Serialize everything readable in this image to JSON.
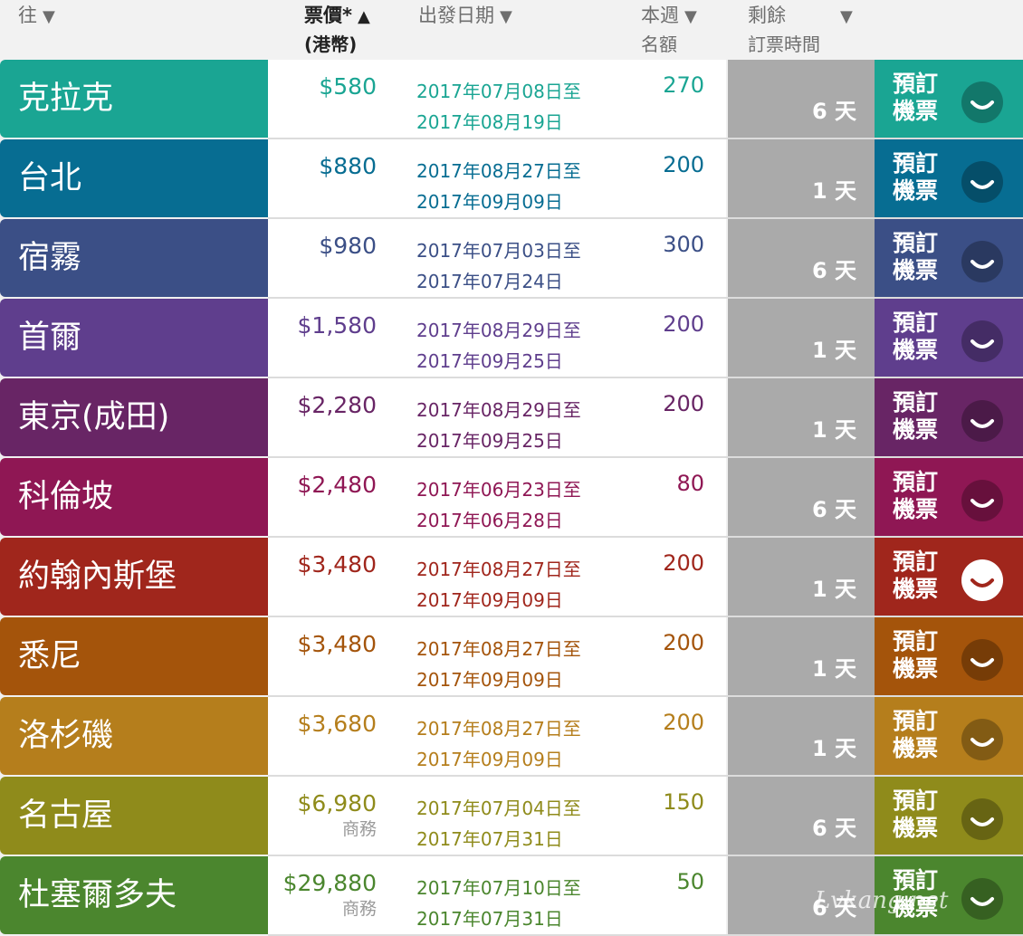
{
  "header": {
    "destination": "往",
    "price": "票價*",
    "price_unit": "(港幣)",
    "date": "出發日期",
    "quota_line1": "本週",
    "quota_line2": "名額",
    "remain_line1": "剩餘",
    "remain_line2": "訂票時間",
    "sort_desc_icon": "▼",
    "sort_asc_icon": "▲"
  },
  "book_label_line1": "預訂",
  "book_label_line2": "機票",
  "rows": [
    {
      "dest": "克拉克",
      "price": "$580",
      "note": "",
      "date_from": "2017年07月08日至",
      "date_to": "2017年08月19日",
      "quota": "270",
      "remain": "6 天",
      "color": "#1aa593",
      "text_color": "#1aa593",
      "active": false
    },
    {
      "dest": "台北",
      "price": "$880",
      "note": "",
      "date_from": "2017年08月27日至",
      "date_to": "2017年09月09日",
      "quota": "200",
      "remain": "1 天",
      "color": "#076d92",
      "text_color": "#076d92",
      "active": false
    },
    {
      "dest": "宿霧",
      "price": "$980",
      "note": "",
      "date_from": "2017年07月03日至",
      "date_to": "2017年07月24日",
      "quota": "300",
      "remain": "6 天",
      "color": "#3b4f86",
      "text_color": "#3b4f86",
      "active": false
    },
    {
      "dest": "首爾",
      "price": "$1,580",
      "note": "",
      "date_from": "2017年08月29日至",
      "date_to": "2017年09月25日",
      "quota": "200",
      "remain": "1 天",
      "color": "#5f3e8d",
      "text_color": "#5f3e8d",
      "active": false
    },
    {
      "dest": "東京(成田)",
      "price": "$2,280",
      "note": "",
      "date_from": "2017年08月29日至",
      "date_to": "2017年09月25日",
      "quota": "200",
      "remain": "1 天",
      "color": "#682565",
      "text_color": "#682565",
      "active": false
    },
    {
      "dest": "科倫坡",
      "price": "$2,480",
      "note": "",
      "date_from": "2017年06月23日至",
      "date_to": "2017年06月28日",
      "quota": "80",
      "remain": "6 天",
      "color": "#8f1754",
      "text_color": "#8f1754",
      "active": false
    },
    {
      "dest": "約翰內斯堡",
      "price": "$3,480",
      "note": "",
      "date_from": "2017年08月27日至",
      "date_to": "2017年09月09日",
      "quota": "200",
      "remain": "1 天",
      "color": "#a0261c",
      "text_color": "#a0261c",
      "active": true
    },
    {
      "dest": "悉尼",
      "price": "$3,480",
      "note": "",
      "date_from": "2017年08月27日至",
      "date_to": "2017年09月09日",
      "quota": "200",
      "remain": "1 天",
      "color": "#a4540b",
      "text_color": "#a4540b",
      "active": false
    },
    {
      "dest": "洛杉磯",
      "price": "$3,680",
      "note": "",
      "date_from": "2017年08月27日至",
      "date_to": "2017年09月09日",
      "quota": "200",
      "remain": "1 天",
      "color": "#b57e1c",
      "text_color": "#b57e1c",
      "active": false
    },
    {
      "dest": "名古屋",
      "price": "$6,980",
      "note": "商務",
      "date_from": "2017年07月04日至",
      "date_to": "2017年07月31日",
      "quota": "150",
      "remain": "6 天",
      "color": "#8f8b1b",
      "text_color": "#8f8b1b",
      "active": false
    },
    {
      "dest": "杜塞爾多夫",
      "price": "$29,880",
      "note": "商務",
      "date_from": "2017年07月10日至",
      "date_to": "2017年07月31日",
      "quota": "50",
      "remain": "6 天",
      "color": "#4b862e",
      "text_color": "#4b862e",
      "active": false
    }
  ],
  "watermark": "Lvkang.net"
}
